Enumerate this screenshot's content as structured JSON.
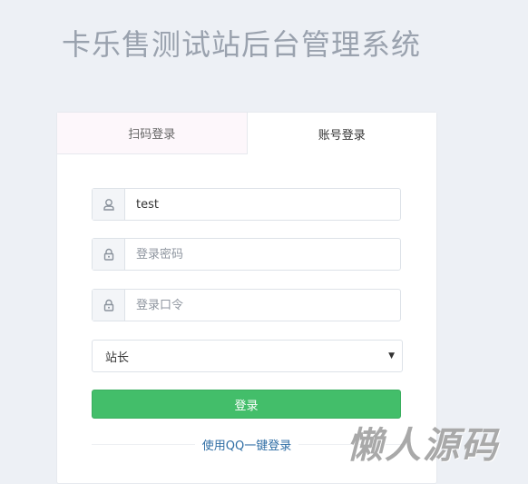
{
  "page_title": "卡乐售测试站后台管理系统",
  "tabs": [
    {
      "label": "扫码登录",
      "active": false
    },
    {
      "label": "账号登录",
      "active": true
    }
  ],
  "form": {
    "username": {
      "value": "test",
      "icon": "user-icon"
    },
    "password": {
      "placeholder": "登录密码",
      "icon": "lock-icon"
    },
    "passcode": {
      "placeholder": "登录口令",
      "icon": "lock-icon"
    },
    "role_select": {
      "selected": "站长"
    },
    "login_button": "登录",
    "qq_login_link": "使用QQ一键登录"
  },
  "watermark": "懒人源码",
  "colors": {
    "background": "#edf0f5",
    "primary_button": "#43be6a",
    "link": "#2e6da4",
    "inactive_tab": "#fdf7fb"
  }
}
